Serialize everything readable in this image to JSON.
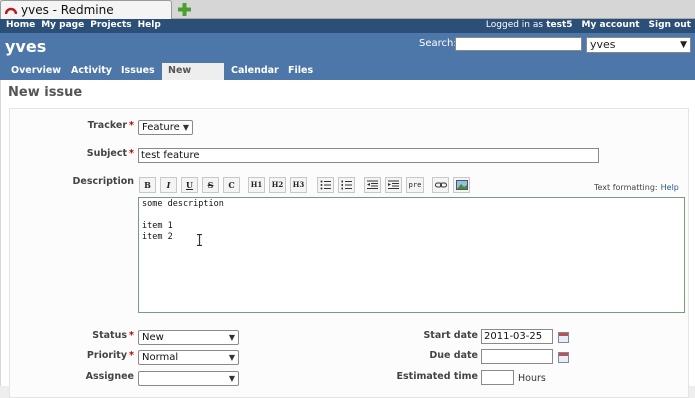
{
  "browser": {
    "tab_title": "yves - Redmine"
  },
  "top_menu": {
    "items": [
      "Home",
      "My page",
      "Projects",
      "Help"
    ],
    "logged_in_prefix": "Logged in as",
    "user": "test5",
    "my_account": "My account",
    "sign_out": "Sign out"
  },
  "header": {
    "project_title": "yves",
    "search_label": "Search:",
    "search_value": "",
    "project_jump": "yves"
  },
  "main_menu": {
    "tabs": [
      "Overview",
      "Activity",
      "Issues",
      "New issue",
      "Calendar",
      "Files"
    ],
    "selected": "New issue"
  },
  "page": {
    "title": "New issue"
  },
  "form": {
    "tracker_label": "Tracker",
    "tracker_value": "Feature",
    "subject_label": "Subject",
    "subject_value": "test feature",
    "description_label": "Description",
    "description_value": "some description\n\nitem 1\nitem 2",
    "toolbar": [
      "B",
      "I",
      "U",
      "S",
      "C",
      "H1",
      "H2",
      "H3",
      "ul",
      "ol",
      "indent-less",
      "indent-more",
      "pre",
      "link",
      "image"
    ],
    "text_formatting_label": "Text formatting:",
    "text_formatting_help": "Help",
    "status_label": "Status",
    "status_value": "New",
    "priority_label": "Priority",
    "priority_value": "Normal",
    "assignee_label": "Assignee",
    "assignee_value": "",
    "start_date_label": "Start date",
    "start_date_value": "2011-03-25",
    "due_date_label": "Due date",
    "due_date_value": "",
    "estimated_time_label": "Estimated time",
    "estimated_time_value": "",
    "hours_label": "Hours",
    "required_marker": "*"
  },
  "colors": {
    "top_menu_bg": "#2c4f77",
    "header_bg": "#4d77a8",
    "required": "#bb0000"
  }
}
